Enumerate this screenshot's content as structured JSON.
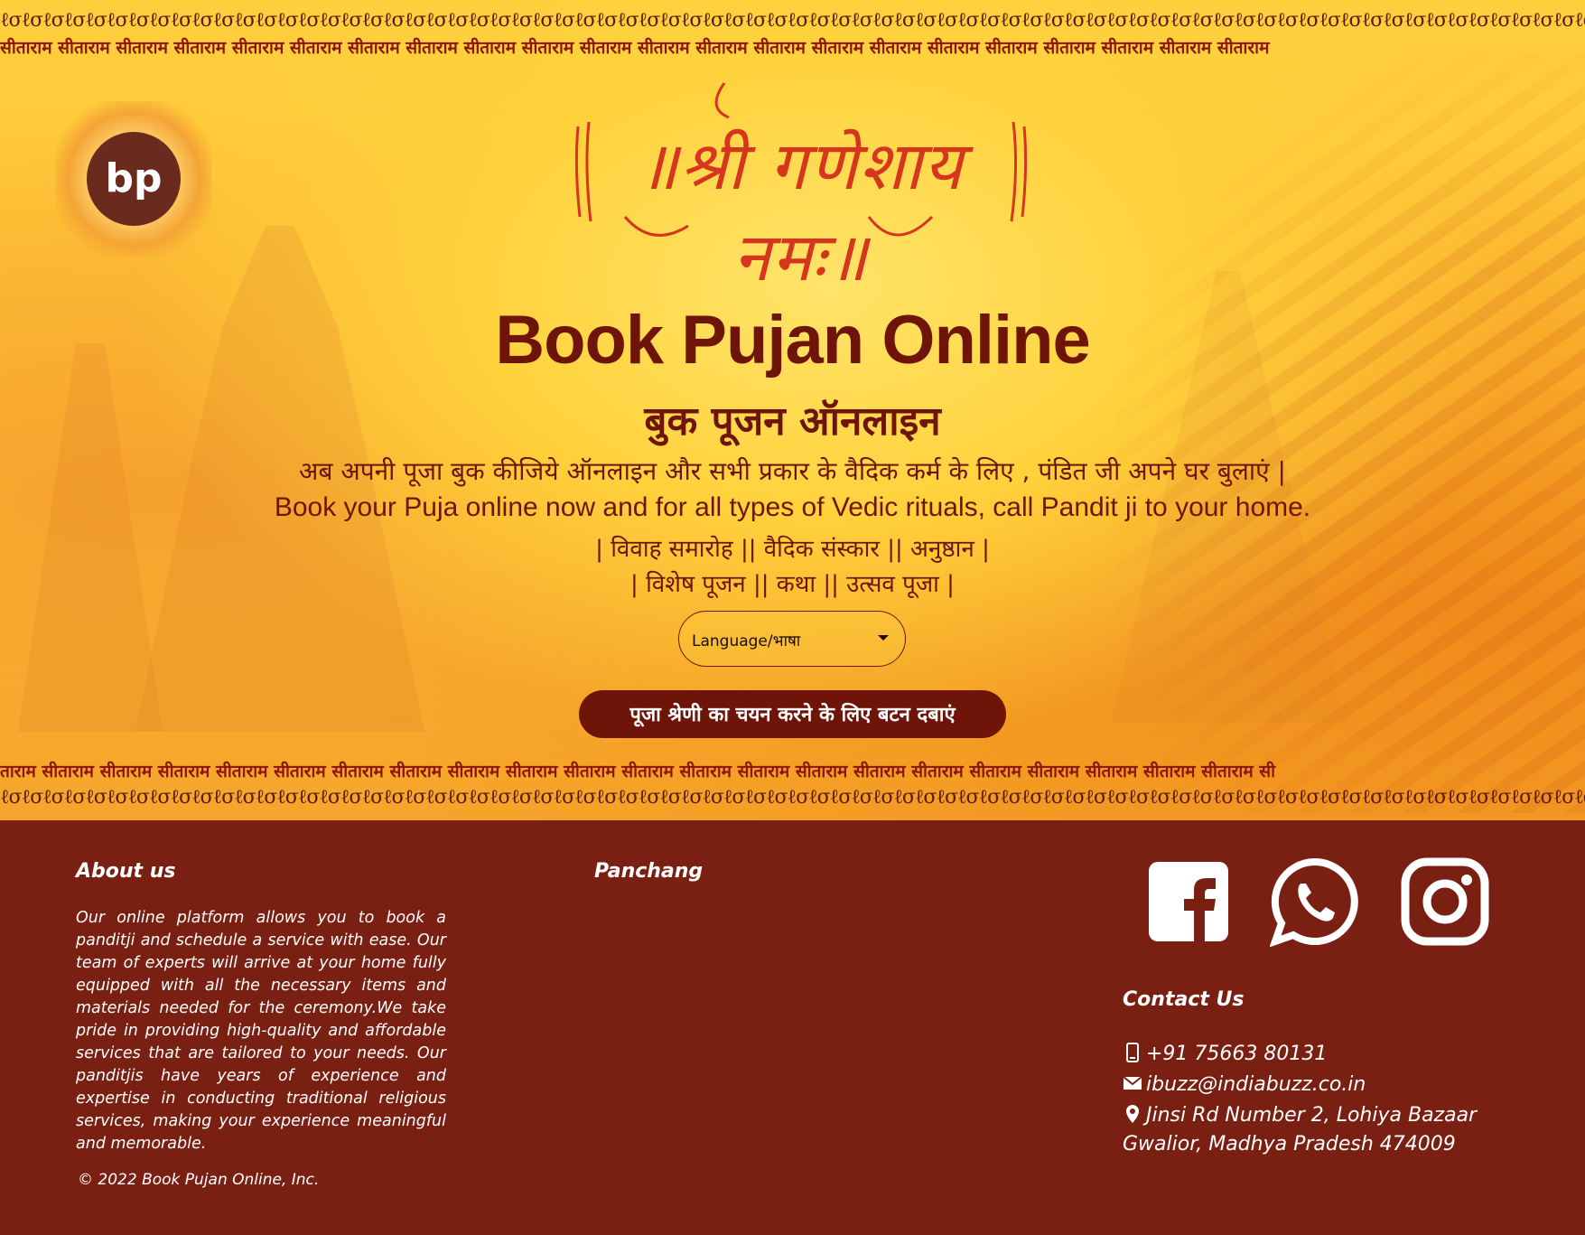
{
  "header": {
    "swirl_pattern": "ℓσℓσℓσℓσℓσℓσℓσℓσℓσℓσℓσℓσℓσℓσℓσℓσℓσℓσℓσℓσℓσℓσℓσℓσℓσℓσℓσℓσℓσℓσℓσℓσℓσℓσℓσℓσℓσℓσℓσℓσℓσℓσℓσℓσℓσℓσℓσℓσℓσℓσℓσℓσℓσℓσℓσℓσℓσℓσℓσℓσℓσℓσℓσℓσℓσℓσℓσℓσℓσℓσℓσℓσℓσℓσℓσℓσℓσℓσℓσℓσℓσℓσℓσℓσℓσℓσ",
    "chant_top": "सीताराम सीताराम सीताराम सीताराम सीताराम सीताराम सीताराम सीताराम सीताराम सीताराम सीताराम सीताराम सीताराम सीताराम सीताराम सीताराम सीताराम सीताराम सीताराम सीताराम सीताराम सीताराम",
    "chant_bottom": "ताराम सीताराम सीताराम सीताराम सीताराम सीताराम सीताराम सीताराम सीताराम सीताराम सीताराम सीताराम सीताराम सीताराम सीताराम सीताराम सीताराम सीताराम सीताराम सीताराम सीताराम सीताराम सी"
  },
  "logo": {
    "text": "bp"
  },
  "invocation": "॥श्री गणेशाय नमः॥",
  "hero": {
    "title_en": "Book Pujan Online",
    "title_hi": "बुक पूजन ऑनलाइन",
    "tagline_hi": "अब अपनी पूजा बुक कीजिये ऑनलाइन और सभी प्रकार के वैदिक कर्म के लिए , पंडित जी अपने घर बुलाएं |",
    "tagline_en": "Book your Puja online now and for all types of Vedic rituals, call Pandit ji to your home.",
    "services_line1": "| विवाह समारोह || वैदिक संस्कार || अनुष्ठान |",
    "services_line2": "| विशेष पूजन || कथा || उत्सव पूजा |",
    "language_select": "Language/भाषा",
    "cta_button": "पूजा श्रेणी का चयन करने के लिए बटन दबाएं"
  },
  "footer": {
    "about_heading": "About us",
    "about_text": "Our online platform allows you to book a panditji and schedule a service with ease. Our team of experts will arrive at your home fully equipped with all the necessary items and materials needed for the ceremony.We take pride in providing high-quality and affordable services that are tailored to your needs. Our panditjis have years of experience and expertise in conducting traditional religious services, making your experience meaningful and memorable.",
    "panchang_heading": "Panchang",
    "contact_heading": "Contact Us",
    "phone": "+91 75663 80131",
    "email": "ibuzz@indiabuzz.co.in",
    "address_line1": "Jinsi Rd Number 2, Lohiya Bazaar",
    "address_line2": "Gwalior, Madhya Pradesh 474009",
    "copyright": "© 2022 Book Pujan Online, Inc.",
    "social_icons": [
      "facebook-icon",
      "whatsapp-icon",
      "instagram-icon"
    ]
  },
  "colors": {
    "brand_maroon": "#6e1409",
    "footer_bg": "#7a2013",
    "hero_yellow": "#ffd23c",
    "invocation_red": "#d6361e"
  }
}
